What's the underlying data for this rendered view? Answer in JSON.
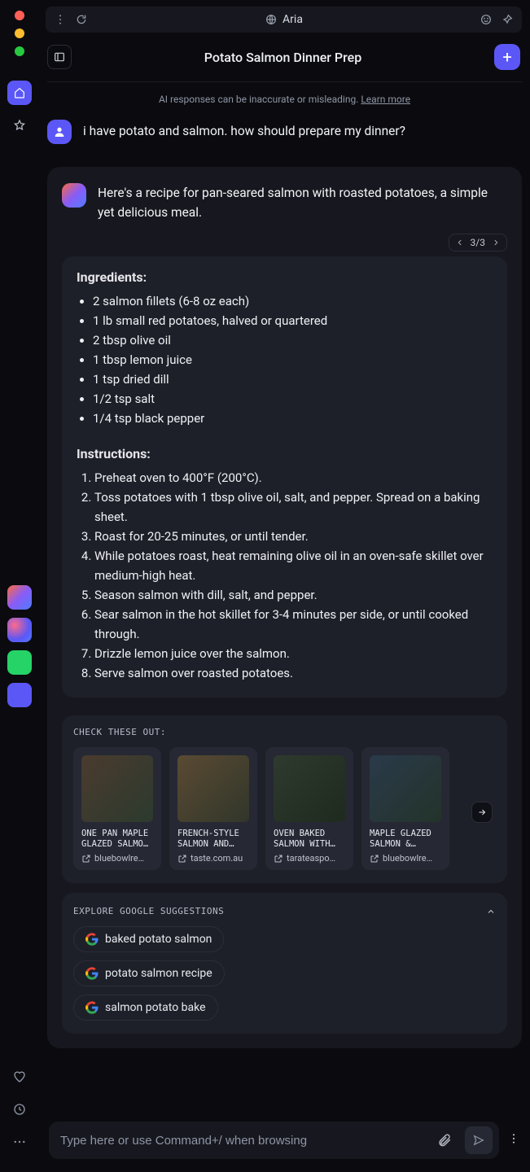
{
  "topbar": {
    "title": "Aria"
  },
  "header": {
    "title": "Potato Salmon Dinner Prep"
  },
  "disclaimer": {
    "text": "AI responses can be inaccurate or misleading. ",
    "learn_more": "Learn more"
  },
  "user": {
    "message": "i have potato and salmon. how should prepare my dinner?"
  },
  "assistant": {
    "intro": "Here's a recipe for pan-seared salmon with roasted potatoes, a simple yet delicious meal.",
    "pager": "3/3"
  },
  "recipe": {
    "ingredients_h": "Ingredients:",
    "instructions_h": "Instructions:",
    "ingredients": [
      "2 salmon fillets (6-8 oz each)",
      "1 lb small red potatoes, halved or quartered",
      "2 tbsp olive oil",
      "1 tbsp lemon juice",
      "1 tsp dried dill",
      "1/2 tsp salt",
      "1/4 tsp black pepper"
    ],
    "instructions": [
      "Preheat oven to 400°F (200°C).",
      "Toss potatoes with 1 tbsp olive oil, salt, and pepper. Spread on a baking sheet.",
      "Roast for 20-25 minutes, or until tender.",
      "While potatoes roast, heat remaining olive oil in an oven-safe skillet over medium-high heat.",
      "Season salmon with dill, salt, and pepper.",
      "Sear salmon in the hot skillet for 3-4 minutes per side, or until cooked through.",
      "Drizzle lemon juice over the salmon.",
      "Serve salmon over roasted potatoes."
    ]
  },
  "cto": {
    "heading": "CHECK THESE OUT:",
    "cards": [
      {
        "title": "ONE PAN MAPLE GLAZED SALMO…",
        "source": "bluebowlre…"
      },
      {
        "title": "FRENCH-STYLE SALMON AND…",
        "source": "taste.com.au"
      },
      {
        "title": "OVEN BAKED SALMON WITH…",
        "source": "tarateaspo…"
      },
      {
        "title": "MAPLE GLAZED SALMON &…",
        "source": "bluebowlre…"
      }
    ]
  },
  "explore": {
    "heading": "EXPLORE GOOGLE SUGGESTIONS",
    "chips": [
      "baked potato salmon",
      "potato salmon recipe",
      "salmon potato bake"
    ]
  },
  "input": {
    "placeholder": "Type here or use Command+/ when browsing"
  }
}
